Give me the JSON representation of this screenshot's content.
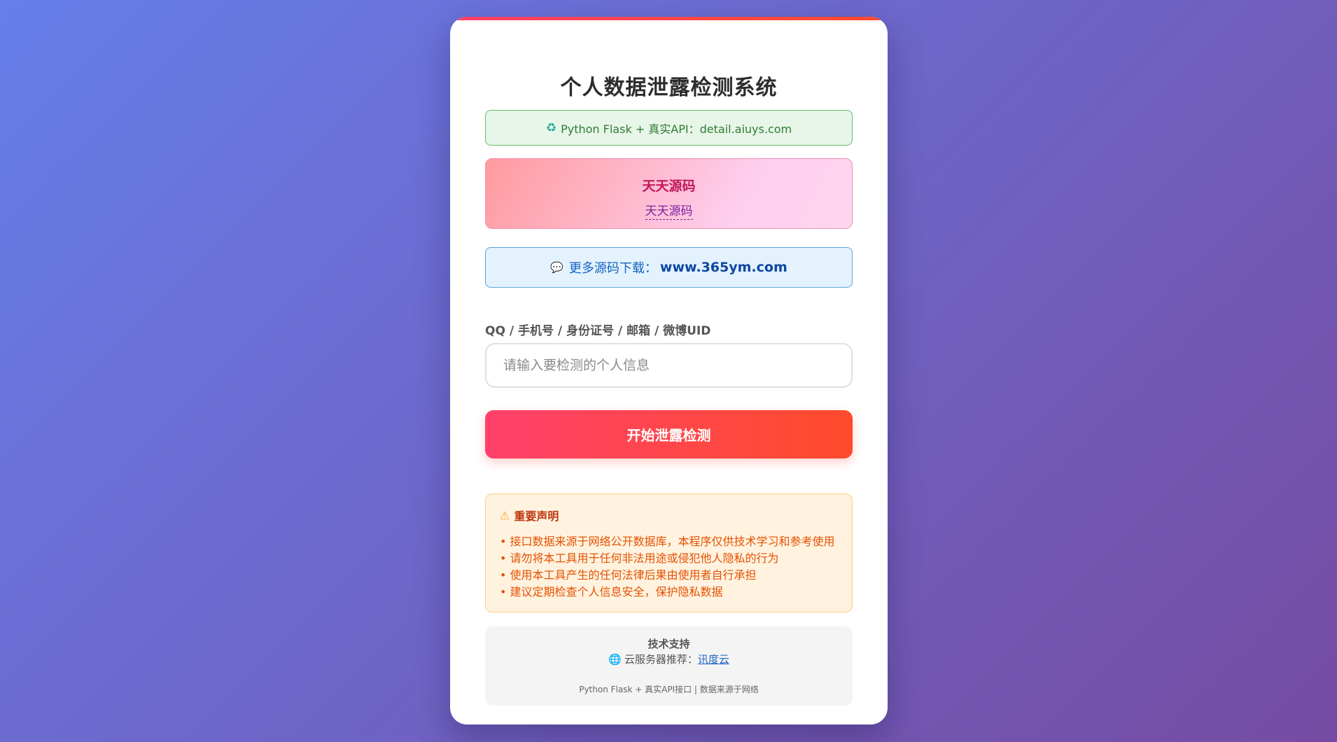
{
  "title": "个人数据泄露检测系统",
  "api_notice": {
    "icon": "recycle-icon",
    "text": "Python Flask + 真实API：detail.aiuys.com"
  },
  "promo": {
    "title": "天天源码",
    "link_text": "天天源码"
  },
  "download": {
    "icon": "speech-bubble-icon",
    "prefix": "更多源码下载：",
    "site": "www.365ym.com"
  },
  "query": {
    "label": "QQ / 手机号 / 身份证号 / 邮箱 / 微博UID",
    "placeholder": "请输入要检测的个人信息",
    "value": ""
  },
  "submit_label": "开始泄露检测",
  "disclaimer": {
    "icon": "warning-icon",
    "title": "重要声明",
    "items": [
      "接口数据来源于网络公开数据库，本程序仅供技术学习和参考使用",
      "请勿将本工具用于任何非法用途或侵犯他人隐私的行为",
      "使用本工具产生的任何法律后果由使用者自行承担",
      "建议定期检查个人信息安全，保护隐私数据"
    ]
  },
  "footer": {
    "title": "技术支持",
    "icon": "globe-icon",
    "server_prefix": "云服务器推荐：",
    "server_link": "讯度云",
    "bottom": "Python Flask + 真实API接口 | 数据来源于网络"
  },
  "colors": {
    "background_start": "#667eea",
    "background_end": "#764ba2",
    "button_start": "#ff416c",
    "button_end": "#ff4b2b"
  }
}
